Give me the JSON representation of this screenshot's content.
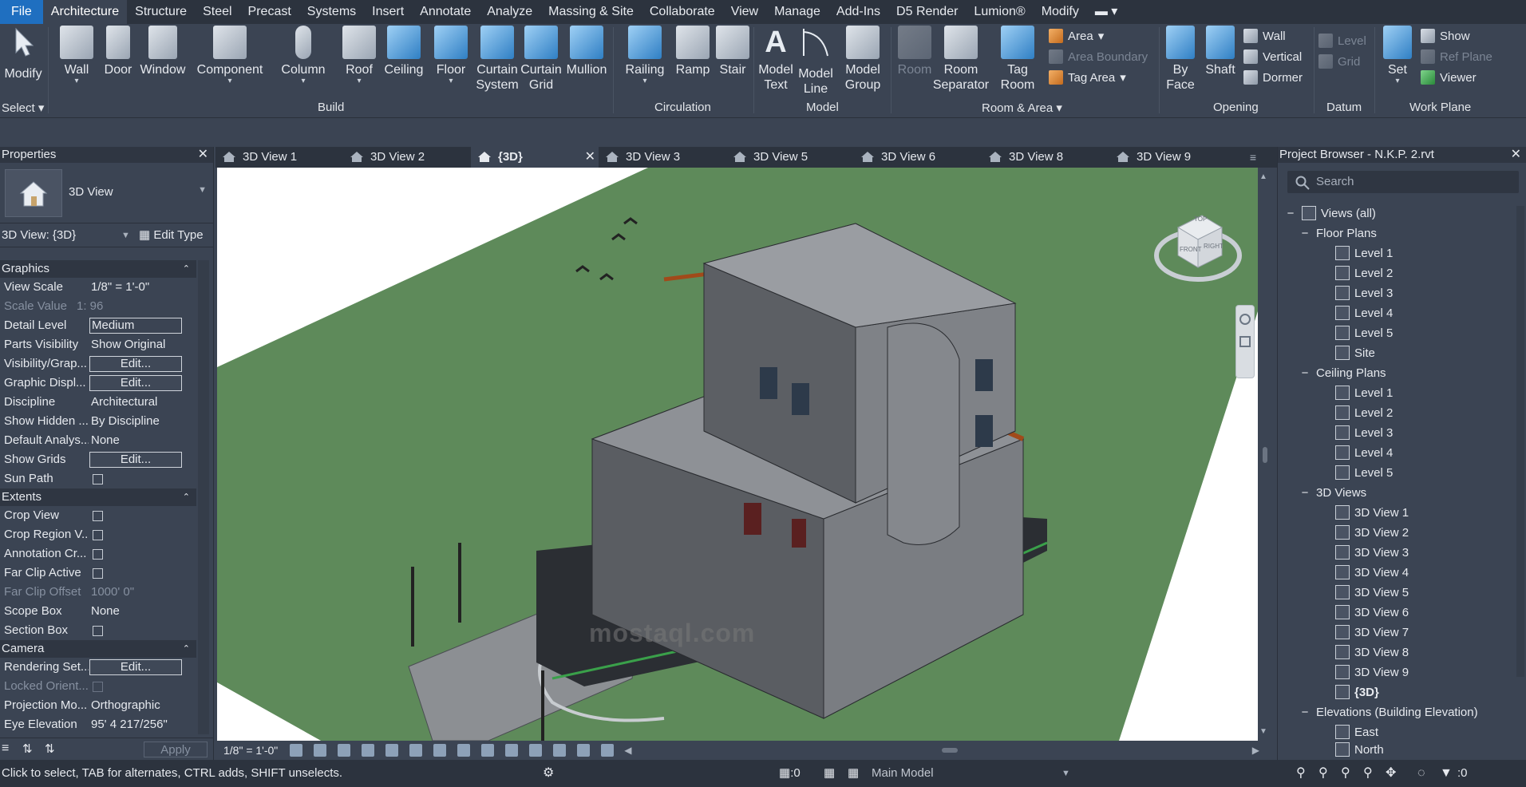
{
  "menu": {
    "items": [
      "File",
      "Architecture",
      "Structure",
      "Steel",
      "Precast",
      "Systems",
      "Insert",
      "Annotate",
      "Analyze",
      "Massing & Site",
      "Collaborate",
      "View",
      "Manage",
      "Add-Ins",
      "D5 Render",
      "Lumion®",
      "Modify"
    ],
    "active": "Architecture"
  },
  "ribbon": {
    "select_label": "Select",
    "panels": {
      "build": "Build",
      "circulation": "Circulation",
      "model": "Model",
      "room_area": "Room & Area",
      "opening": "Opening",
      "datum": "Datum",
      "work_plane": "Work Plane"
    },
    "tools": {
      "modify": "Modify",
      "wall": "Wall",
      "door": "Door",
      "window": "Window",
      "component": "Component",
      "column": "Column",
      "roof": "Roof",
      "ceiling": "Ceiling",
      "floor": "Floor",
      "curtain_system_1": "Curtain",
      "curtain_system_2": "System",
      "curtain_grid_1": "Curtain",
      "curtain_grid_2": "Grid",
      "mullion": "Mullion",
      "railing": "Railing",
      "ramp": "Ramp",
      "stair": "Stair",
      "model_text_1": "Model",
      "model_text_2": "Text",
      "model_line_1": "Model",
      "model_line_2": "Line",
      "model_group_1": "Model",
      "model_group_2": "Group",
      "room": "Room",
      "room_sep_1": "Room",
      "room_sep_2": "Separator",
      "tag_room_1": "Tag",
      "tag_room_2": "Room",
      "area": "Area",
      "area_boundary": "Area  Boundary",
      "tag_area": "Tag  Area",
      "by_face_1": "By",
      "by_face_2": "Face",
      "shaft": "Shaft",
      "wall_open": "Wall",
      "vertical": "Vertical",
      "dormer": "Dormer",
      "level": "Level",
      "grid": "Grid",
      "set": "Set",
      "show": "Show",
      "ref_plane": "Ref  Plane",
      "viewer": "Viewer"
    }
  },
  "properties": {
    "title": "Properties",
    "type_name": "3D View",
    "instance_selector": "3D View: {3D}",
    "edit_type": "Edit Type",
    "sections": {
      "graphics": "Graphics",
      "extents": "Extents",
      "camera": "Camera"
    },
    "rows": {
      "view_scale": {
        "k": "View Scale",
        "v": "1/8\" = 1'-0\""
      },
      "scale_value": {
        "k": "Scale Value",
        "v": "1:  96"
      },
      "detail_level": {
        "k": "Detail Level",
        "v": "Medium"
      },
      "parts_visibility": {
        "k": "Parts Visibility",
        "v": "Show Original"
      },
      "visibility_graphics": {
        "k": "Visibility/Grap...",
        "v": "Edit..."
      },
      "graphic_display": {
        "k": "Graphic Displ...",
        "v": "Edit..."
      },
      "discipline": {
        "k": "Discipline",
        "v": "Architectural"
      },
      "show_hidden": {
        "k": "Show Hidden ...",
        "v": "By Discipline"
      },
      "default_analysis": {
        "k": "Default Analys...",
        "v": "None"
      },
      "show_grids": {
        "k": "Show Grids",
        "v": "Edit..."
      },
      "sun_path": {
        "k": "Sun Path"
      },
      "crop_view": {
        "k": "Crop View"
      },
      "crop_region": {
        "k": "Crop Region V..."
      },
      "annotation_crop": {
        "k": "Annotation Cr..."
      },
      "far_clip_active": {
        "k": "Far Clip Active"
      },
      "far_clip_offset": {
        "k": "Far Clip Offset",
        "v": "1000'  0\""
      },
      "scope_box": {
        "k": "Scope Box",
        "v": "None"
      },
      "section_box": {
        "k": "Section Box"
      },
      "rendering_settings": {
        "k": "Rendering Set...",
        "v": "Edit..."
      },
      "locked_orientation": {
        "k": "Locked Orient..."
      },
      "projection_mode": {
        "k": "Projection Mo...",
        "v": "Orthographic"
      },
      "eye_elevation": {
        "k": "Eye Elevation",
        "v": "95'  4 217/256\""
      }
    },
    "apply": "Apply"
  },
  "tabs": [
    "3D View 1",
    "3D View 2",
    "{3D}",
    "3D View 3",
    "3D View 5",
    "3D View 6",
    "3D View 8",
    "3D View 9"
  ],
  "active_tab": "{3D}",
  "viewcube": {
    "top": "TOP",
    "front": "FRONT",
    "right": "RIGHT"
  },
  "view_bar": {
    "scale": "1/8\" = 1'-0\""
  },
  "watermark": {
    "text": "mostaql.com"
  },
  "browser": {
    "title": "Project Browser - N.K.P. 2.rvt",
    "search_placeholder": "Search",
    "root": "Views (all)",
    "floor_plans": "Floor Plans",
    "floor_plan_items": [
      "Level 1",
      "Level 2",
      "Level 3",
      "Level 4",
      "Level 5",
      "Site"
    ],
    "ceiling_plans": "Ceiling Plans",
    "ceiling_plan_items": [
      "Level 1",
      "Level 2",
      "Level 3",
      "Level 4",
      "Level 5"
    ],
    "views_3d": "3D Views",
    "views_3d_items": [
      "3D View 1",
      "3D View 2",
      "3D View 3",
      "3D View 4",
      "3D View 5",
      "3D View 6",
      "3D View 7",
      "3D View 8",
      "3D View 9",
      "{3D}"
    ],
    "elevations": "Elevations (Building Elevation)",
    "elevation_items": [
      "East",
      "North"
    ]
  },
  "status": {
    "hint": "Click to select, TAB for alternates, CTRL adds, SHIFT unselects.",
    "count_a": ":0",
    "model": "Main Model",
    "filter_count": ":0"
  }
}
